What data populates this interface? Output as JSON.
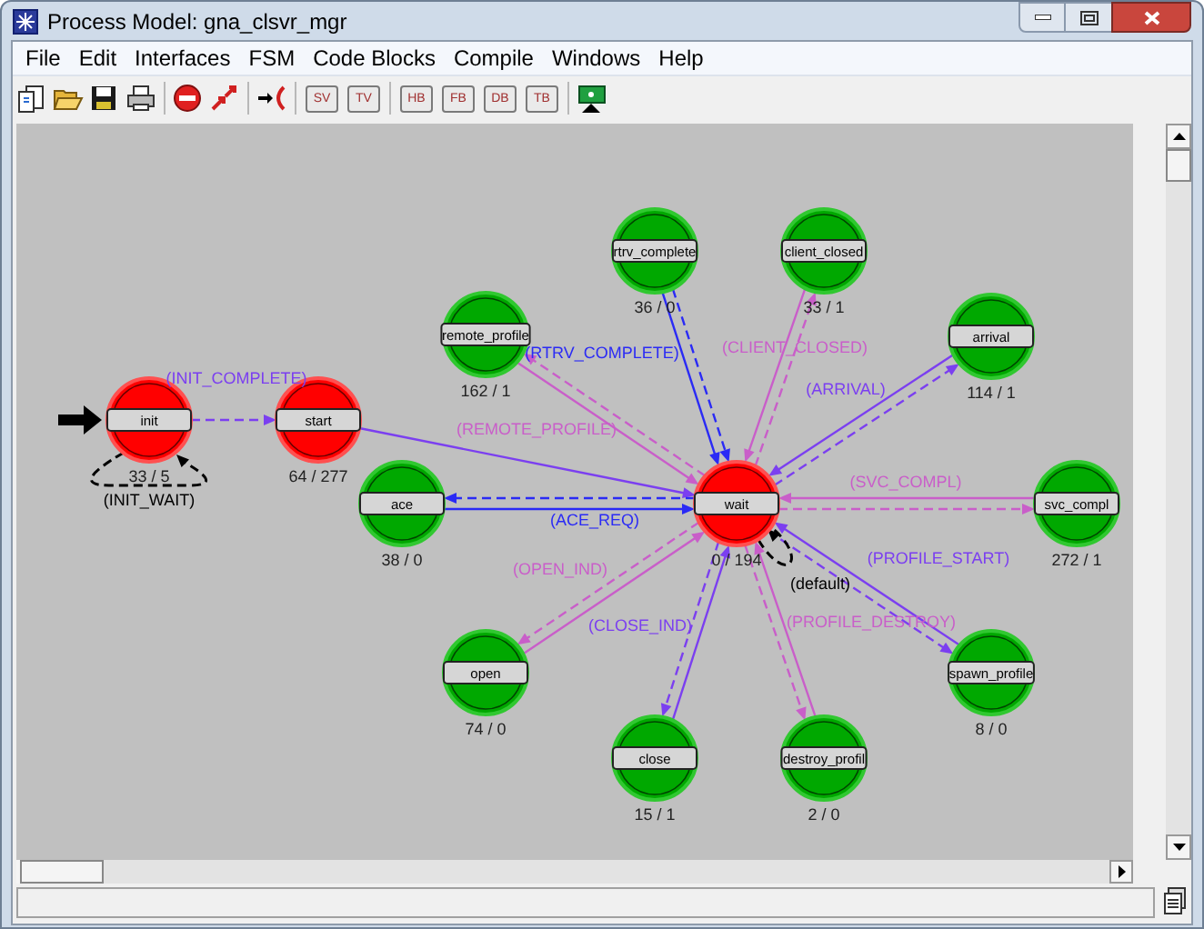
{
  "window": {
    "title": "Process Model: gna_clsvr_mgr"
  },
  "menu": [
    {
      "label": "File"
    },
    {
      "label": "Edit"
    },
    {
      "label": "Interfaces"
    },
    {
      "label": "FSM"
    },
    {
      "label": "Code Blocks"
    },
    {
      "label": "Compile"
    },
    {
      "label": "Windows"
    },
    {
      "label": "Help"
    }
  ],
  "toolbar": [
    {
      "kind": "new"
    },
    {
      "kind": "open"
    },
    {
      "kind": "save"
    },
    {
      "kind": "print"
    },
    {
      "kind": "abort"
    },
    {
      "kind": "arrows"
    },
    {
      "kind": "entry"
    },
    {
      "kind": "text",
      "label": "SV"
    },
    {
      "kind": "text",
      "label": "TV"
    },
    {
      "kind": "text",
      "label": "HB"
    },
    {
      "kind": "text",
      "label": "FB"
    },
    {
      "kind": "text",
      "label": "DB"
    },
    {
      "kind": "text",
      "label": "TB"
    },
    {
      "kind": "monitor"
    }
  ],
  "states": [
    {
      "name": "init",
      "count": "33 / 5",
      "forced": true,
      "initial": true
    },
    {
      "name": "start",
      "count": "64 / 277",
      "forced": true,
      "initial": false
    },
    {
      "name": "remote_profile",
      "count": "162 / 1",
      "forced": false,
      "initial": false
    },
    {
      "name": "ace",
      "count": "38 / 0",
      "forced": false,
      "initial": false
    },
    {
      "name": "rtrv_complete",
      "count": "36 / 0",
      "forced": false,
      "initial": false
    },
    {
      "name": "client_closed",
      "count": "33 / 1",
      "forced": false,
      "initial": false
    },
    {
      "name": "arrival",
      "count": "114 / 1",
      "forced": false,
      "initial": false
    },
    {
      "name": "wait",
      "count": "0 / 194",
      "forced": true,
      "initial": false
    },
    {
      "name": "svc_compl",
      "count": "272 / 1",
      "forced": false,
      "initial": false
    },
    {
      "name": "open",
      "count": "74 / 0",
      "forced": false,
      "initial": false
    },
    {
      "name": "close",
      "count": "15 / 1",
      "forced": false,
      "initial": false
    },
    {
      "name": "destroy_profil",
      "count": "2 / 0",
      "forced": false,
      "initial": false
    },
    {
      "name": "spawn_profile",
      "count": "8 / 0",
      "forced": false,
      "initial": false
    }
  ],
  "transitions": [
    {
      "kind": "conditional",
      "color": "#7b3ff0",
      "label": "(INIT_COMPLETE)"
    },
    {
      "kind": "conditional",
      "color": "#000000",
      "label": "(INIT_WAIT)"
    },
    {
      "kind": "unconditional",
      "color": "#7b3ff0"
    },
    {
      "kind": "conditional",
      "color": "#c95ec9",
      "label": "(REMOTE_PROFILE)"
    },
    {
      "kind": "unconditional",
      "color": "#c95ec9"
    },
    {
      "kind": "unconditional",
      "color": "#2a2af5",
      "label": "(RTRV_COMPLETE)"
    },
    {
      "kind": "conditional",
      "color": "#2a2af5"
    },
    {
      "kind": "conditional",
      "color": "#c95ec9",
      "label": "(CLIENT_CLOSED)"
    },
    {
      "kind": "unconditional",
      "color": "#c95ec9"
    },
    {
      "kind": "conditional",
      "color": "#7b3ff0",
      "label": "(ARRIVAL)"
    },
    {
      "kind": "unconditional",
      "color": "#7b3ff0"
    },
    {
      "kind": "conditional",
      "color": "#2a2af5",
      "label": "(ACE_REQ)"
    },
    {
      "kind": "unconditional",
      "color": "#2a2af5"
    },
    {
      "kind": "conditional",
      "color": "#c95ec9",
      "label": "(SVC_COMPL)"
    },
    {
      "kind": "unconditional",
      "color": "#c95ec9"
    },
    {
      "kind": "conditional",
      "color": "#c95ec9",
      "label": "(OPEN_IND)"
    },
    {
      "kind": "unconditional",
      "color": "#c95ec9"
    },
    {
      "kind": "conditional",
      "color": "#7b3ff0",
      "label": "(PROFILE_START)"
    },
    {
      "kind": "unconditional",
      "color": "#7b3ff0"
    },
    {
      "kind": "conditional",
      "color": "#000000",
      "label": "(default)"
    },
    {
      "kind": "conditional",
      "color": "#7b3ff0",
      "label": "(CLOSE_IND)"
    },
    {
      "kind": "unconditional",
      "color": "#7b3ff0"
    },
    {
      "kind": "conditional",
      "color": "#c95ec9",
      "label": "(PROFILE_DESTROY)"
    },
    {
      "kind": "unconditional",
      "color": "#c95ec9"
    }
  ]
}
